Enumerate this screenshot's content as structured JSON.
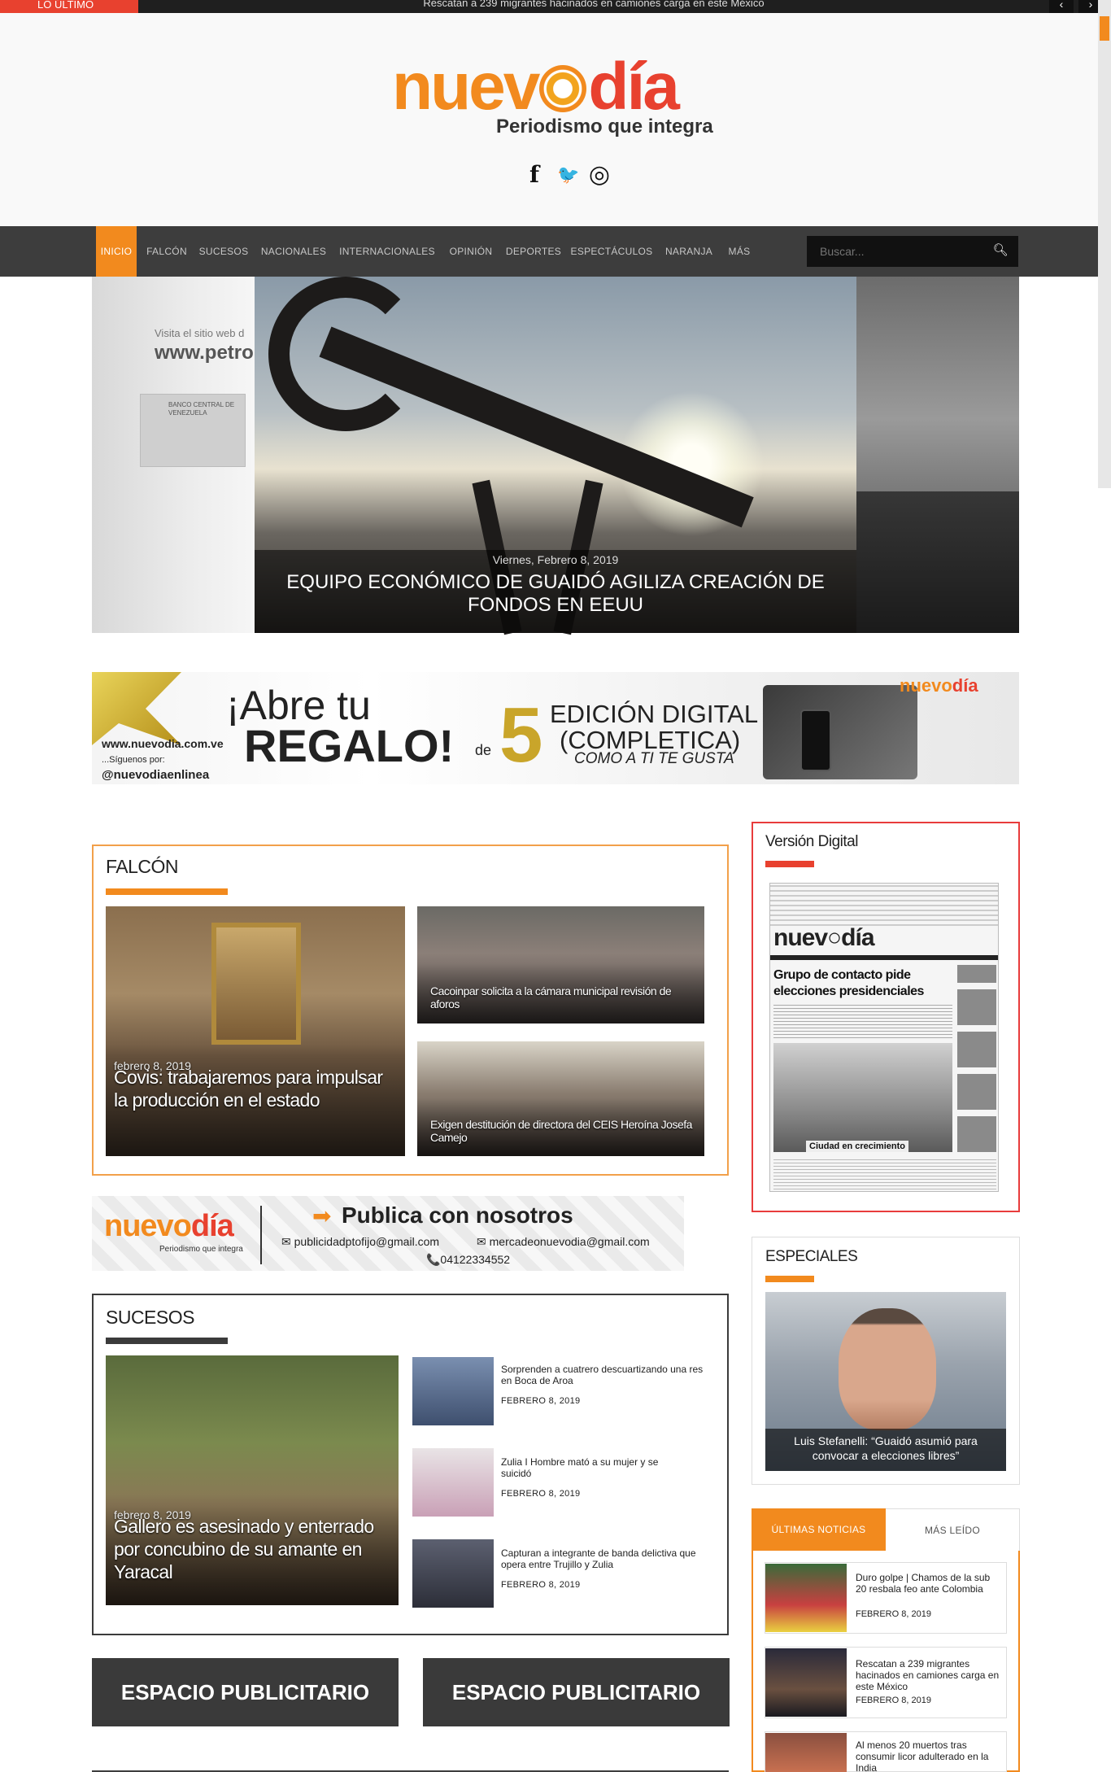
{
  "topbar": {
    "label": "LO ÚLTIMO",
    "ticker": "Rescatan a 239 migrantes hacinados en camiones carga en este México",
    "prev": "‹",
    "next": "›"
  },
  "brand": {
    "name_a": "nuev",
    "name_b": "día",
    "tagline": "Periodismo que integra"
  },
  "social": {
    "facebook": "f",
    "twitter": "🐦",
    "instagram": "◎"
  },
  "nav": {
    "items": [
      "INICIO",
      "FALCÓN",
      "SUCESOS",
      "NACIONALES",
      "INTERNACIONALES",
      "OPINIÓN",
      "DEPORTES",
      "ESPECTÁCULOS",
      "NARANJA",
      "MÁS"
    ],
    "search_placeholder": "Buscar..."
  },
  "slider": {
    "left_text1": "Visita el sitio web d",
    "left_text2": "www.petro",
    "left_logo": "BANCO CENTRAL DE VENEZUELA",
    "date": "Viernes, Febrero 8, 2019",
    "title": "EQUIPO ECONÓMICO DE GUAIDÓ AGILIZA CREACIÓN DE FONDOS EN EEUU"
  },
  "banner": {
    "abre": "¡Abre tu",
    "regalo": "REGALO!",
    "de": "de",
    "five": "5",
    "edicion1": "EDICIÓN DIGITAL",
    "edicion2": "(COMPLETICA)",
    "edicion3": "COMO A TI TE GUSTA",
    "url": "www.nuevodia.com.ve",
    "siguenos": "...Síguenos por:",
    "handle": "@nuevodiaenlinea",
    "logo_a": "nuevo",
    "logo_b": "día"
  },
  "falcon": {
    "title": "FALCÓN",
    "main": {
      "date": "febrero 8, 2019",
      "title": "Covis: trabajaremos para impulsar la producción en el estado"
    },
    "side": [
      {
        "title": "Cacoinpar solicita a la cámara municipal revisión de aforos"
      },
      {
        "title": "Exigen destitución de directora del CEIS Heroína Josefa Camejo"
      }
    ]
  },
  "publica": {
    "arrow": "➡",
    "title": "Publica con nosotros",
    "email1": "✉ publicidadptofijo@gmail.com",
    "email2": "✉ mercadeonuevodia@gmail.com",
    "phone": "📞04122334552",
    "logo_a": "nuevo",
    "logo_b": "día",
    "logo_tag": "Periodismo que integra"
  },
  "sucesos": {
    "title": "SUCESOS",
    "main": {
      "date": "febrero 8, 2019",
      "title": "Gallero es asesinado y enterrado por concubino de su amante en Yaracal"
    },
    "list": [
      {
        "title": "Sorprenden a cuatrero descuartizando una res en Boca de Aroa",
        "date": "FEBRERO 8, 2019"
      },
      {
        "title": "Zulia I Hombre mató a su mujer y se suicidó",
        "date": "FEBRERO 8, 2019"
      },
      {
        "title": "Capturan a integrante de banda delictiva que opera entre Trujillo y Zulia",
        "date": "FEBRERO 8, 2019"
      }
    ]
  },
  "ads": {
    "left": "ESPACIO PUBLICITARIO",
    "right": "ESPACIO PUBLICITARIO"
  },
  "version_digital": {
    "title": "Versión Digital",
    "paper_headline1": "Grupo de contacto pide",
    "paper_headline2": "elecciones presidenciales",
    "paper_caption": "Ciudad en crecimiento",
    "paper_masthead_a": "nuev",
    "paper_masthead_b": "día"
  },
  "especiales": {
    "title": "ESPECIALES",
    "caption": "Luis Stefanelli: “Guaidó asumió para convocar a elecciones libres”"
  },
  "tabs": {
    "active": "ÚLTIMAS NOTICIAS",
    "inactive": "MÁS LEÍDO",
    "items": [
      {
        "title": "Duro golpe | Chamos de la sub 20 resbala feo ante Colombia",
        "date": "FEBRERO 8, 2019"
      },
      {
        "title": "Rescatan a 239 migrantes hacinados en camiones carga en este México",
        "date": "FEBRERO 8, 2019"
      },
      {
        "title": "Al menos 20 muertos tras consumir licor adulterado en la India",
        "date": ""
      }
    ]
  },
  "colors": {
    "accent": "#f28a1e",
    "red": "#e8412f",
    "nav": "#3d3d3d"
  }
}
